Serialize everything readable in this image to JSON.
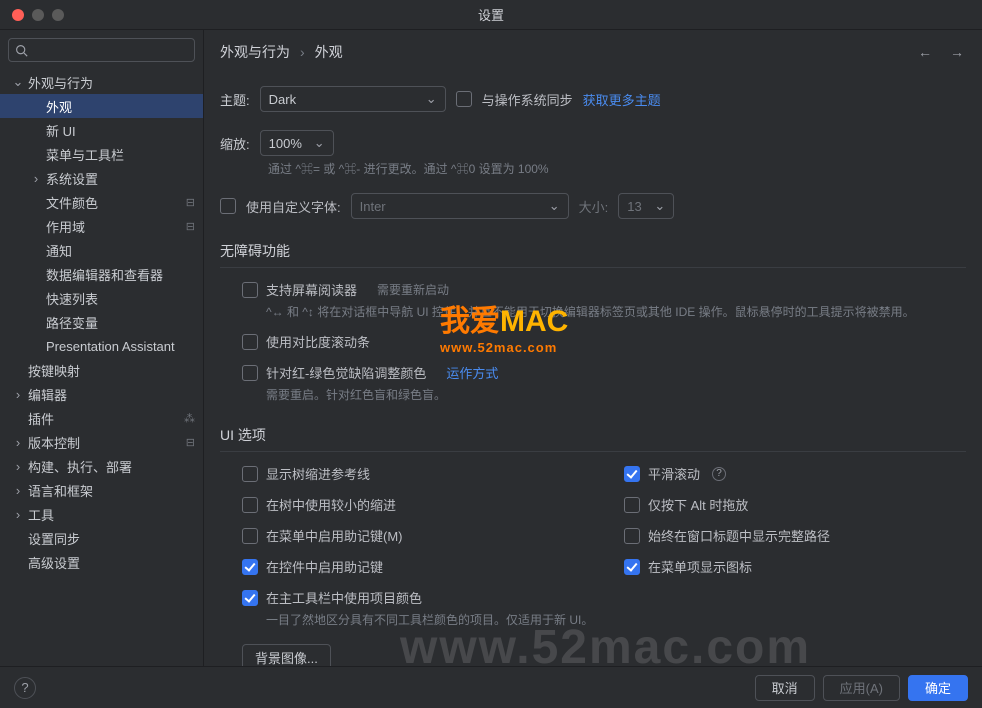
{
  "window": {
    "title": "设置"
  },
  "search": {
    "placeholder": ""
  },
  "breadcrumb": {
    "root": "外观与行为",
    "sep": "›",
    "leaf": "外观"
  },
  "sidebar": {
    "items": [
      {
        "label": "外观与行为",
        "depth": 0,
        "expandable": true,
        "expanded": true
      },
      {
        "label": "外观",
        "depth": 1,
        "selected": true
      },
      {
        "label": "新 UI",
        "depth": 1
      },
      {
        "label": "菜单与工具栏",
        "depth": 1
      },
      {
        "label": "系统设置",
        "depth": 1,
        "expandable": true
      },
      {
        "label": "文件颜色",
        "depth": 1,
        "trail": "⊟"
      },
      {
        "label": "作用域",
        "depth": 1,
        "trail": "⊟"
      },
      {
        "label": "通知",
        "depth": 1
      },
      {
        "label": "数据编辑器和查看器",
        "depth": 1
      },
      {
        "label": "快速列表",
        "depth": 1
      },
      {
        "label": "路径变量",
        "depth": 1
      },
      {
        "label": "Presentation Assistant",
        "depth": 1
      },
      {
        "label": "按键映射",
        "depth": 0
      },
      {
        "label": "编辑器",
        "depth": 0,
        "expandable": true
      },
      {
        "label": "插件",
        "depth": 0,
        "trail": "⁂"
      },
      {
        "label": "版本控制",
        "depth": 0,
        "expandable": true,
        "trail": "⊟"
      },
      {
        "label": "构建、执行、部署",
        "depth": 0,
        "expandable": true
      },
      {
        "label": "语言和框架",
        "depth": 0,
        "expandable": true
      },
      {
        "label": "工具",
        "depth": 0,
        "expandable": true
      },
      {
        "label": "设置同步",
        "depth": 0
      },
      {
        "label": "高级设置",
        "depth": 0
      }
    ]
  },
  "theme": {
    "label": "主题:",
    "value": "Dark",
    "sync_label": "与操作系统同步",
    "more_link": "获取更多主题"
  },
  "zoom": {
    "label": "缩放:",
    "value": "100%",
    "hint": "通过 ^⌘= 或 ^⌘- 进行更改。通过 ^⌘0 设置为 100%"
  },
  "font": {
    "label": "使用自定义字体:",
    "name": "Inter",
    "size_label": "大小:",
    "size": "13"
  },
  "a11y": {
    "heading": "无障碍功能",
    "screen_reader": "支持屏幕阅读器",
    "screen_reader_hint1": "需要重新启动",
    "screen_reader_hint2": "^↔ 和 ^↕ 将在对话框中导航 UI 控件，并且不能用于切换编辑器标签页或其他 IDE 操作。鼠标悬停时的工具提示将被禁用。",
    "contrast_scroll": "使用对比度滚动条",
    "vision_adjust": "针对红-绿色觉缺陷调整颜色",
    "how_link": "运作方式",
    "vision_hint": "需要重启。针对红色盲和绿色盲。"
  },
  "ui_options": {
    "heading": "UI 选项",
    "left": [
      {
        "label": "显示树缩进参考线",
        "checked": false
      },
      {
        "label": "在树中使用较小的缩进",
        "checked": false
      },
      {
        "label": "在菜单中启用助记键(M)",
        "checked": false
      },
      {
        "label": "在控件中启用助记键",
        "checked": true
      },
      {
        "label": "在主工具栏中使用项目颜色",
        "checked": true
      }
    ],
    "left_hint": "一目了然地区分具有不同工具栏颜色的项目。仅适用于新 UI。",
    "right": [
      {
        "label": "平滑滚动",
        "checked": true,
        "help": true
      },
      {
        "label": "仅按下 Alt 时拖放",
        "checked": false
      },
      {
        "label": "始终在窗口标题中显示完整路径",
        "checked": false
      },
      {
        "label": "在菜单项显示图标",
        "checked": true
      }
    ],
    "bg_button": "背景图像..."
  },
  "footer": {
    "cancel": "取消",
    "apply": "应用(A)",
    "ok": "确定"
  },
  "watermark": {
    "line1": "我爱",
    "line1b": "MAC",
    "line2": "www.52mac.com",
    "big": "www.52mac.com"
  }
}
